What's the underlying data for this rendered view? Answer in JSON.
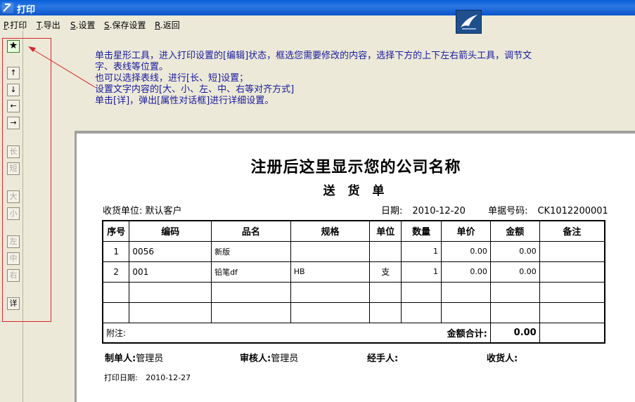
{
  "window": {
    "title": "打印"
  },
  "menu": [
    {
      "hotkey": "P",
      "label": ".打印"
    },
    {
      "hotkey": "T",
      "label": ".导出"
    },
    {
      "hotkey": "S",
      "label": ".设置"
    },
    {
      "hotkey": "S",
      "label": ".保存设置"
    },
    {
      "hotkey": "R",
      "label": ".返回"
    }
  ],
  "toolbar": {
    "star": "★",
    "up": "↑",
    "down": "↓",
    "left": "←",
    "right": "→",
    "long": "长",
    "short": "短",
    "big": "大",
    "small": "小",
    "align_left": "左",
    "align_center": "中",
    "align_right": "右",
    "detail": "详"
  },
  "instructions": [
    "单击星形工具，进入打印设置的[编辑]状态，框选您需要修改的内容，选择下方的上下左右箭头工具，调节文",
    "字、表线等位置。",
    "也可以选择表线，进行[长、短]设置；",
    "设置文字内容的[大、小、左、中、右等对齐方式]",
    "单击[详]，弹出[属性对话框]进行详细设置。"
  ],
  "document": {
    "company": "注册后这里显示您的公司名称",
    "title": "送 货 单",
    "receiver_label": "收货单位:",
    "receiver": "默认客户",
    "date_label": "日期:",
    "date": "2010-12-20",
    "doc_no_label": "单据号码:",
    "doc_no": "CK1012200001",
    "columns": [
      "序号",
      "编码",
      "品名",
      "规格",
      "单位",
      "数量",
      "单价",
      "金额",
      "备注"
    ],
    "rows": [
      {
        "no": "1",
        "code": "0056",
        "name": "新版",
        "spec": "",
        "unit": "",
        "qty": "1",
        "price": "0.00",
        "amount": "0.00",
        "note": ""
      },
      {
        "no": "2",
        "code": "001",
        "name": "铅笔df",
        "spec": "HB",
        "unit": "支",
        "qty": "1",
        "price": "0.00",
        "amount": "0.00",
        "note": ""
      }
    ],
    "remark_label": "附注:",
    "total_label": "金额合计:",
    "total": "0.00",
    "maker_label": "制单人:",
    "maker": "管理员",
    "auditor_label": "审核人:",
    "auditor": "管理员",
    "handler_label": "经手人:",
    "handler": "",
    "consignee_label": "收货人:",
    "consignee": "",
    "print_date_label": "打印日期:",
    "print_date": "2010-12-27"
  },
  "colors": {
    "titlebar": "#0a5fd8",
    "instructions": "#1a1aa0",
    "highlight": "#d8262b"
  }
}
